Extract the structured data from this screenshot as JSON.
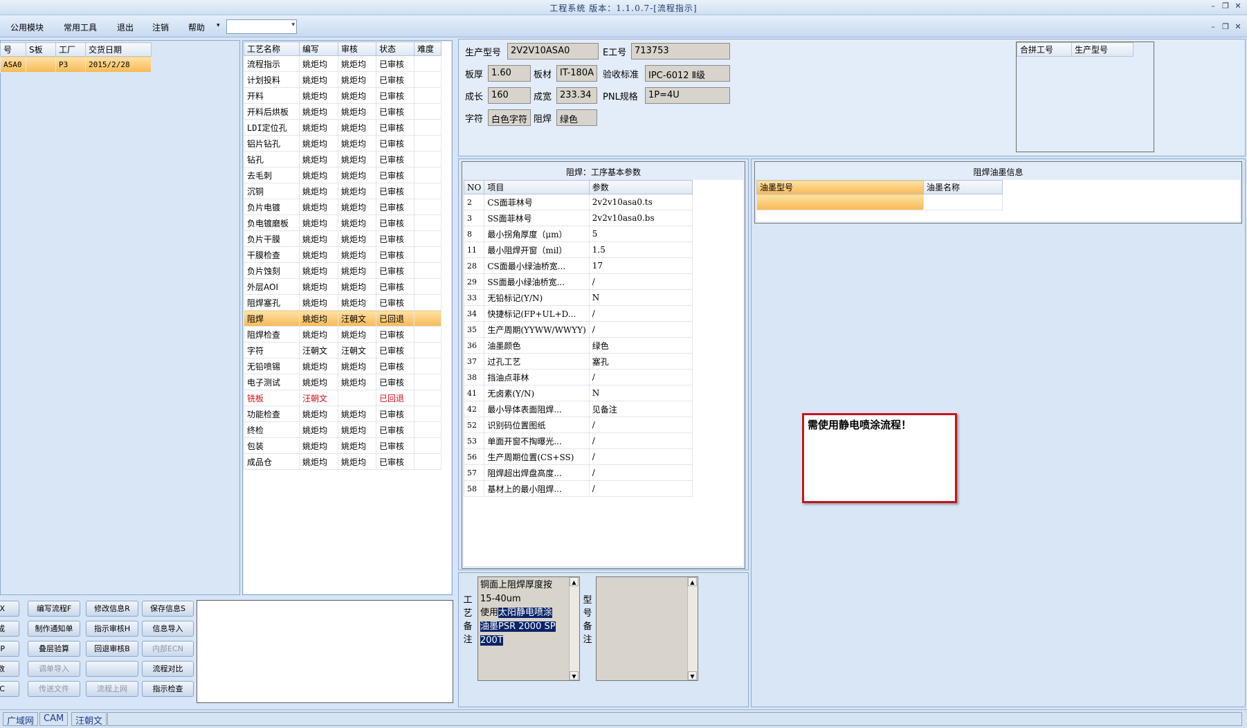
{
  "window": {
    "title": "工程系统 版本：1.1.0.7-[流程指示]",
    "controls": [
      "–",
      "❐",
      "✕"
    ],
    "mdi_controls": [
      "–",
      "❐",
      "✕"
    ]
  },
  "menu": [
    "公用模块",
    "常用工具",
    "退出",
    "注销",
    "帮助"
  ],
  "menu_arrow": "▾",
  "orders": {
    "headers": [
      "号",
      "S板",
      "工厂",
      "交货日期"
    ],
    "rows": [
      [
        "ASA0",
        "",
        "P3",
        "2015/2/28"
      ]
    ]
  },
  "process": {
    "headers": [
      "工艺名称",
      "编写",
      "审核",
      "状态",
      "难度"
    ],
    "rows": [
      [
        "流程指示",
        "姚炬均",
        "姚炬均",
        "已审核",
        ""
      ],
      [
        "计划投料",
        "姚炬均",
        "姚炬均",
        "已审核",
        ""
      ],
      [
        "开料",
        "姚炬均",
        "姚炬均",
        "已审核",
        ""
      ],
      [
        "开料后烘板",
        "姚炬均",
        "姚炬均",
        "已审核",
        ""
      ],
      [
        "LDI定位孔",
        "姚炬均",
        "姚炬均",
        "已审核",
        ""
      ],
      [
        "铝片钻孔",
        "姚炬均",
        "姚炬均",
        "已审核",
        ""
      ],
      [
        "钻孔",
        "姚炬均",
        "姚炬均",
        "已审核",
        ""
      ],
      [
        "去毛刺",
        "姚炬均",
        "姚炬均",
        "已审核",
        ""
      ],
      [
        "沉铜",
        "姚炬均",
        "姚炬均",
        "已审核",
        ""
      ],
      [
        "负片电镀",
        "姚炬均",
        "姚炬均",
        "已审核",
        ""
      ],
      [
        "负电镀磨板",
        "姚炬均",
        "姚炬均",
        "已审核",
        ""
      ],
      [
        "负片干膜",
        "姚炬均",
        "姚炬均",
        "已审核",
        ""
      ],
      [
        "干膜检查",
        "姚炬均",
        "姚炬均",
        "已审核",
        ""
      ],
      [
        "负片蚀刻",
        "姚炬均",
        "姚炬均",
        "已审核",
        ""
      ],
      [
        "外层AOI",
        "姚炬均",
        "姚炬均",
        "已审核",
        ""
      ],
      [
        "阻焊塞孔",
        "姚炬均",
        "姚炬均",
        "已审核",
        ""
      ],
      [
        "阻焊",
        "姚炬均",
        "汪朝文",
        "已回退",
        ""
      ],
      [
        "阻焊检查",
        "姚炬均",
        "姚炬均",
        "已审核",
        ""
      ],
      [
        "字符",
        "汪朝文",
        "汪朝文",
        "已审核",
        ""
      ],
      [
        "无铅喷锡",
        "姚炬均",
        "姚炬均",
        "已审核",
        ""
      ],
      [
        "电子测试",
        "姚炬均",
        "姚炬均",
        "已审核",
        ""
      ],
      [
        "铣板",
        "汪朝文",
        "",
        "已回退",
        ""
      ],
      [
        "功能检查",
        "姚炬均",
        "姚炬均",
        "已审核",
        ""
      ],
      [
        "终检",
        "姚炬均",
        "姚炬均",
        "已审核",
        ""
      ],
      [
        "包装",
        "姚炬均",
        "姚炬均",
        "已审核",
        ""
      ],
      [
        "成品仓",
        "姚炬均",
        "姚炬均",
        "已审核",
        ""
      ]
    ],
    "selected_index": 16,
    "red_index": 21
  },
  "info": {
    "product_model_label": "生产型号",
    "product_model": "2V2V10ASA0",
    "e_no_label": "E工号",
    "e_no": "713753",
    "thickness_label": "板厚",
    "thickness": "1.60",
    "material_label": "板材",
    "material": "IT-180A",
    "accept_label": "验收标准",
    "accept": "IPC-6012 Ⅱ级",
    "length_label": "成长",
    "length": "160",
    "width_label": "成宽",
    "width": "233.34",
    "pnl_label": "PNL规格",
    "pnl": "1P=4U",
    "char_label": "字符",
    "char": "白色字符",
    "mask_label": "阻焊",
    "mask": "绿色"
  },
  "combine": {
    "headers": [
      "合拼工号",
      "生产型号"
    ]
  },
  "params": {
    "title": "阻焊：工序基本参数",
    "headers": [
      "NO",
      "项目",
      "参数"
    ],
    "rows": [
      [
        "2",
        "CS面菲林号",
        "2v2v10asa0.ts"
      ],
      [
        "3",
        "SS面菲林号",
        "2v2v10asa0.bs"
      ],
      [
        "8",
        "最小拐角厚度（μm）",
        "5"
      ],
      [
        "11",
        "最小阻焊开窗（mil）",
        "1.5"
      ],
      [
        "28",
        "CS面最小绿油桥宽...",
        "17"
      ],
      [
        "29",
        "SS面最小绿油桥宽...",
        "/"
      ],
      [
        "33",
        "无铅标记(Y/N)",
        "N"
      ],
      [
        "34",
        "快捷标记(FP+UL+D...",
        "/"
      ],
      [
        "35",
        "生产周期(YYWW/WWYY)",
        "/"
      ],
      [
        "36",
        "油墨颜色",
        "绿色"
      ],
      [
        "37",
        "过孔工艺",
        "塞孔"
      ],
      [
        "38",
        "挡油点菲林",
        "/"
      ],
      [
        "41",
        "无卤素(Y/N)",
        "N"
      ],
      [
        "42",
        "最小导体表面阻焊...",
        "见备注"
      ],
      [
        "52",
        "识别码位置图纸",
        "/"
      ],
      [
        "53",
        "单面开窗不掏曝光...",
        "/"
      ],
      [
        "56",
        "生产周期位置(CS+SS)",
        "/"
      ],
      [
        "57",
        "阻焊超出焊盘高度...",
        "/"
      ],
      [
        "58",
        "基材上的最小阻焊...",
        "/"
      ]
    ]
  },
  "ink": {
    "title": "阻焊油墨信息",
    "headers": [
      "油墨型号",
      "油墨名称"
    ]
  },
  "notice": "需使用静电喷涂流程！",
  "remarks": {
    "process_label": [
      "工",
      "艺",
      "备",
      "注"
    ],
    "model_label": [
      "型",
      "号",
      "备",
      "注"
    ],
    "process_text_plain": [
      "铜面上阻焊厚度按",
      "15-40um"
    ],
    "process_text_mixed_pre": "使用",
    "process_text_mixed_sel": "太阳静电喷涂",
    "process_text_sel": [
      "油墨PSR 2000 SP",
      "200T"
    ]
  },
  "buttons": [
    [
      "查询X",
      "编写流程F",
      "修改信息R",
      "保存信息S"
    ],
    [
      "完成",
      "制作通知单",
      "指示审核H",
      "信息导入"
    ],
    [
      "WIP",
      "叠层验算",
      "回退审核B",
      "内部ECN"
    ],
    [
      "参数",
      "调单导入",
      "",
      "流程对比"
    ],
    [
      "修改C",
      "传送文件",
      "流程上网",
      "指示检查"
    ]
  ],
  "disabled_buttons": [
    "内部ECN",
    "调单导入",
    "传送文件",
    "流程上网"
  ],
  "status": [
    "广域网",
    "CAM",
    "汪朝文"
  ]
}
